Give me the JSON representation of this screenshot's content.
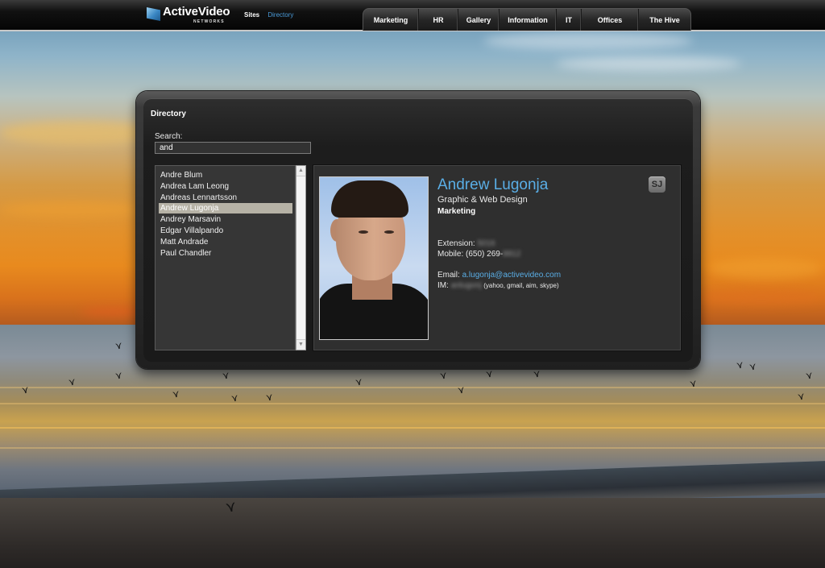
{
  "header": {
    "logo_text": "ActiveVideo",
    "logo_subtext": "NETWORKS",
    "crumbs": {
      "sites": "Sites",
      "directory": "Directory"
    },
    "nav": [
      "Marketing",
      "HR",
      "Gallery",
      "Information",
      "IT",
      "Offices",
      "The Hive"
    ]
  },
  "directory": {
    "title": "Directory",
    "search_label": "Search:",
    "search_value": "and",
    "results": [
      "Andre Blum",
      "Andrea Lam Leong",
      "Andreas Lennartsson",
      "Andrew Lugonja",
      "Andrey Marsavin",
      "Edgar Villalpando",
      "Matt Andrade",
      "Paul Chandler"
    ],
    "selected_index": 3
  },
  "profile": {
    "name": "Andrew Lugonja",
    "title": "Graphic & Web Design",
    "department": "Marketing",
    "extension_label": "Extension:",
    "extension_value": "5016",
    "mobile_label": "Mobile:",
    "mobile_value": "(650) 269-",
    "mobile_hidden": "8812",
    "email_label": "Email:",
    "email_value": "a.lugonja@activevideo.com",
    "im_label": "IM:",
    "im_value": "anlugonj",
    "im_services": "(yahoo, gmail, aim, skype)",
    "badge": "SJ"
  }
}
